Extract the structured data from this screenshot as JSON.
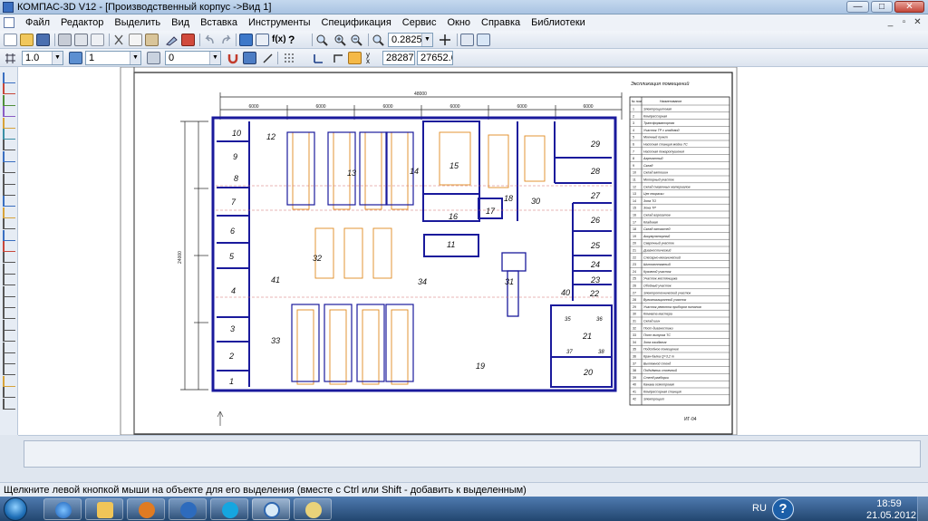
{
  "window": {
    "title": "КОМПАС-3D V12 - [Производственный корпус ->Вид 1]",
    "min_glyph": "—",
    "max_glyph": "□",
    "close_glyph": "✕"
  },
  "menu": [
    "Файл",
    "Редактор",
    "Выделить",
    "Вид",
    "Вставка",
    "Инструменты",
    "Спецификация",
    "Сервис",
    "Окно",
    "Справка",
    "Библиотеки"
  ],
  "toolbar": {
    "zoom_value": "0.2825",
    "style_value": "1.0",
    "layer_value": "1",
    "state_value": "0",
    "coord_x": "28287.6",
    "coord_y": "27652.6",
    "coord_x_label": "x",
    "coord_y_label": "y"
  },
  "drawing": {
    "table_title": "Экспликация помещений",
    "table_header_num": "№ пом",
    "table_header_name": "Наименование",
    "table_rows": [
      "Электрощитовая",
      "Компрессорная",
      "Трансформаторная",
      "Участок ТР с кладовой",
      "Моечный пункт",
      "Насосная станция мойки ТС",
      "Насосная пожаротушения",
      "Агрегатный",
      "Склад",
      "Склад автошин",
      "Моторный участок",
      "Склад смазочных материалов",
      "Цех покраски",
      "Зона ТО",
      "Зона ТР",
      "Склад агрегатов",
      "Кладовая",
      "Склад запчастей",
      "Аккумуляторный",
      "Сварочный участок",
      "Диагностический",
      "Слесарно-механический",
      "Шиномонтажный",
      "Кузовной участок",
      "Участок жестянщика",
      "Обойный участок",
      "Электротехнический участок",
      "Вулканизационный участок",
      "Участок ремонта приборов питания",
      "Комната мастера",
      "Склад шин",
      "Пост диагностики",
      "Пост выпуска ТС",
      "Зона ожидания",
      "Подсобное помещение",
      "Кран-балка Q=3,2 т",
      "Вытяжной стенд",
      "Подъёмник стоечный",
      "Стенд разборки",
      "Канава осмотровая",
      "Компрессорная станция",
      "Электрощит"
    ],
    "room_numbers": [
      "1",
      "2",
      "3",
      "4",
      "5",
      "6",
      "7",
      "8",
      "9",
      "10",
      "11",
      "12",
      "13",
      "14",
      "15",
      "16",
      "17",
      "18",
      "19",
      "20",
      "21",
      "22",
      "23",
      "24",
      "25",
      "26",
      "27",
      "28",
      "29",
      "30",
      "31",
      "32",
      "33",
      "34",
      "35",
      "36",
      "37",
      "38",
      "40",
      "41"
    ],
    "dimension_total": "48000",
    "dimension_span": "6000",
    "dimension_vertical": "24000",
    "stamp_text": "ИГ-04"
  },
  "status_bar": {
    "text": "Щелкните левой кнопкой мыши на объекте для его выделения (вместе с Ctrl или Shift - добавить к выделенным)"
  },
  "taskbar": {
    "lang": "RU",
    "time": "18:59",
    "date": "21.05.2012",
    "help_glyph": "?"
  }
}
